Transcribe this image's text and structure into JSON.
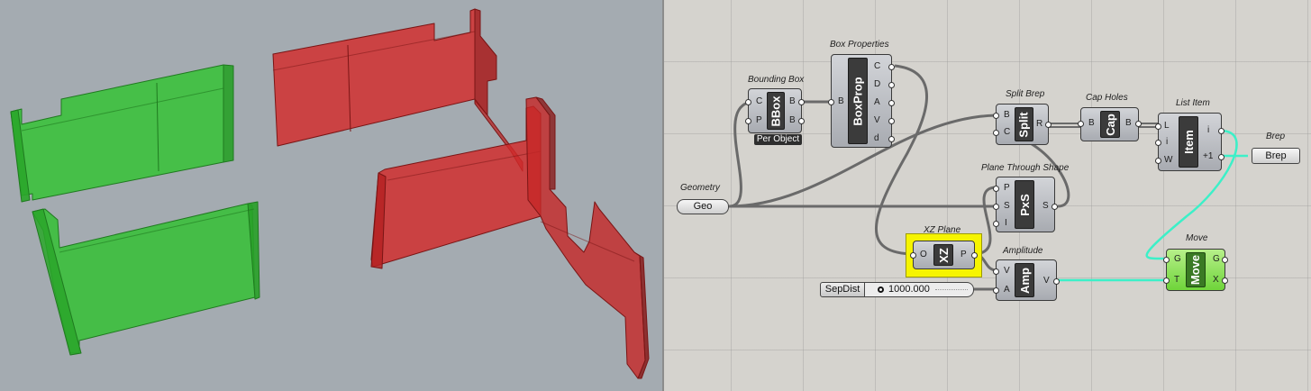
{
  "viewport": {
    "colors": {
      "background": "#a4abb1",
      "green": "#2fc82f",
      "red": "#d22a2a"
    }
  },
  "canvas": {
    "components": {
      "bbox": {
        "title": "Bounding Box",
        "name": "BBox",
        "inputs": [
          "C",
          "P"
        ],
        "outputs": [
          "B",
          "B"
        ],
        "tag": "Per Object"
      },
      "boxprop": {
        "title": "Box Properties",
        "name": "BoxProp",
        "inputs": [
          "B"
        ],
        "outputs": [
          "C",
          "D",
          "A",
          "V",
          "d"
        ]
      },
      "split": {
        "title": "Split Brep",
        "name": "Split",
        "inputs": [
          "B",
          "C"
        ],
        "outputs": [
          "R"
        ]
      },
      "cap": {
        "title": "Cap Holes",
        "name": "Cap",
        "inputs": [
          "B"
        ],
        "outputs": [
          "B"
        ]
      },
      "list": {
        "title": "List Item",
        "name": "Item",
        "inputs": [
          "L",
          "i",
          "W"
        ],
        "outputs": [
          "i",
          "+1"
        ]
      },
      "brep": {
        "title": "Brep",
        "name": "Brep"
      },
      "geometry": {
        "title": "Geometry",
        "name": "Geo"
      },
      "pxs": {
        "title": "Plane Through Shape",
        "name": "PxS",
        "inputs": [
          "P",
          "S",
          "I"
        ],
        "outputs": [
          "S"
        ]
      },
      "xz": {
        "title": "XZ Plane",
        "name": "XZ",
        "inputs": [
          "O"
        ],
        "outputs": [
          "P"
        ]
      },
      "amp": {
        "title": "Amplitude",
        "name": "Amp",
        "inputs": [
          "V",
          "A"
        ],
        "outputs": [
          "V"
        ]
      },
      "move": {
        "title": "Move",
        "name": "Move",
        "inputs": [
          "G",
          "T"
        ],
        "outputs": [
          "G",
          "X"
        ]
      },
      "slider": {
        "label": "SepDist",
        "value": "1000.000"
      }
    },
    "colors": {
      "wire": "#6a6a6a",
      "highlight_wire": "#3cf0c8",
      "selected": "#f6f400",
      "move_green": "#8be05a"
    }
  }
}
